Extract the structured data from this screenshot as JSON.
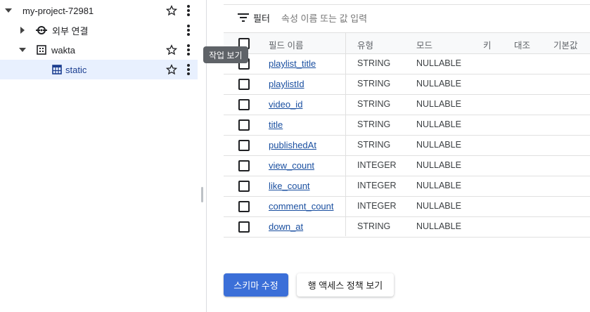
{
  "sidebar": {
    "project": {
      "label": "my-project-72981"
    },
    "external": {
      "label": "외부 연결"
    },
    "dataset": {
      "label": "wakta"
    },
    "table": {
      "label": "static"
    }
  },
  "tooltip": {
    "text": "작업 보기"
  },
  "filter": {
    "label": "필터",
    "placeholder": "속성 이름 또는 값 입력"
  },
  "schema": {
    "headers": {
      "name": "필드 이름",
      "type": "유형",
      "mode": "모드",
      "key": "키",
      "collation": "대조",
      "default": "기본값"
    },
    "rows": [
      {
        "name": "playlist_title",
        "type": "STRING",
        "mode": "NULLABLE"
      },
      {
        "name": "playlistId",
        "type": "STRING",
        "mode": "NULLABLE"
      },
      {
        "name": "video_id",
        "type": "STRING",
        "mode": "NULLABLE"
      },
      {
        "name": "title",
        "type": "STRING",
        "mode": "NULLABLE"
      },
      {
        "name": "publishedAt",
        "type": "STRING",
        "mode": "NULLABLE"
      },
      {
        "name": "view_count",
        "type": "INTEGER",
        "mode": "NULLABLE"
      },
      {
        "name": "like_count",
        "type": "INTEGER",
        "mode": "NULLABLE"
      },
      {
        "name": "comment_count",
        "type": "INTEGER",
        "mode": "NULLABLE"
      },
      {
        "name": "down_at",
        "type": "STRING",
        "mode": "NULLABLE"
      }
    ]
  },
  "buttons": {
    "edit_schema": "스키마 수정",
    "row_access": "행 액세스 정책 보기"
  },
  "colors": {
    "accent": "#3b6fd8",
    "link": "#1a4fa0",
    "selected": "#e8f0fe",
    "tooltip": "#5f6368"
  },
  "icons": [
    "caret-down-icon",
    "caret-right-icon",
    "external-connection-icon",
    "dataset-icon",
    "table-icon",
    "star-icon",
    "more-vert-icon",
    "filter-icon"
  ]
}
